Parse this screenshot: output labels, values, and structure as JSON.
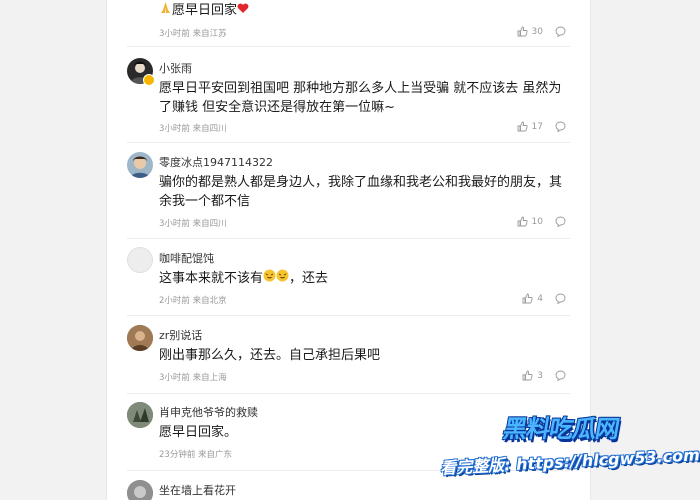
{
  "comments": [
    {
      "username": "",
      "text": "愿早日回家",
      "meta": "3小时前 来自江苏",
      "likes": "30"
    },
    {
      "username": "小张雨",
      "text": "愿早日平安回到祖国吧 那种地方那么多人上当受骗 就不应该去 虽然为了赚钱 但安全意识还是得放在第一位嘛~",
      "meta": "3小时前 来自四川",
      "likes": "17"
    },
    {
      "username": "零度冰点1947114322",
      "text": "骗你的都是熟人都是身边人，我除了血缘和我老公和我最好的朋友，其余我一个都不信",
      "meta": "3小时前 来自四川",
      "likes": "10"
    },
    {
      "username": "咖啡配馄饨",
      "text_a": "这事本来就不该有",
      "text_b": "，还去",
      "meta": "2小时前 来自北京",
      "likes": "4"
    },
    {
      "username": "zr别说话",
      "text": "刚出事那么久，还去。自己承担后果吧",
      "meta": "3小时前 来自上海",
      "likes": "3"
    },
    {
      "username": "肖申克他爷爷的救赎",
      "text": "愿早日回家。",
      "meta": "23分钟前 来自广东",
      "likes": ""
    },
    {
      "username": "坐在墙上看花开",
      "text": "",
      "meta": "",
      "likes": ""
    }
  ],
  "icons": {
    "like": "thumbs-up-icon",
    "reply": "speech-bubble-icon"
  },
  "watermark": {
    "line1": "黑料吃瓜网",
    "line2": "看完整版: https://hlcgw53.com"
  }
}
